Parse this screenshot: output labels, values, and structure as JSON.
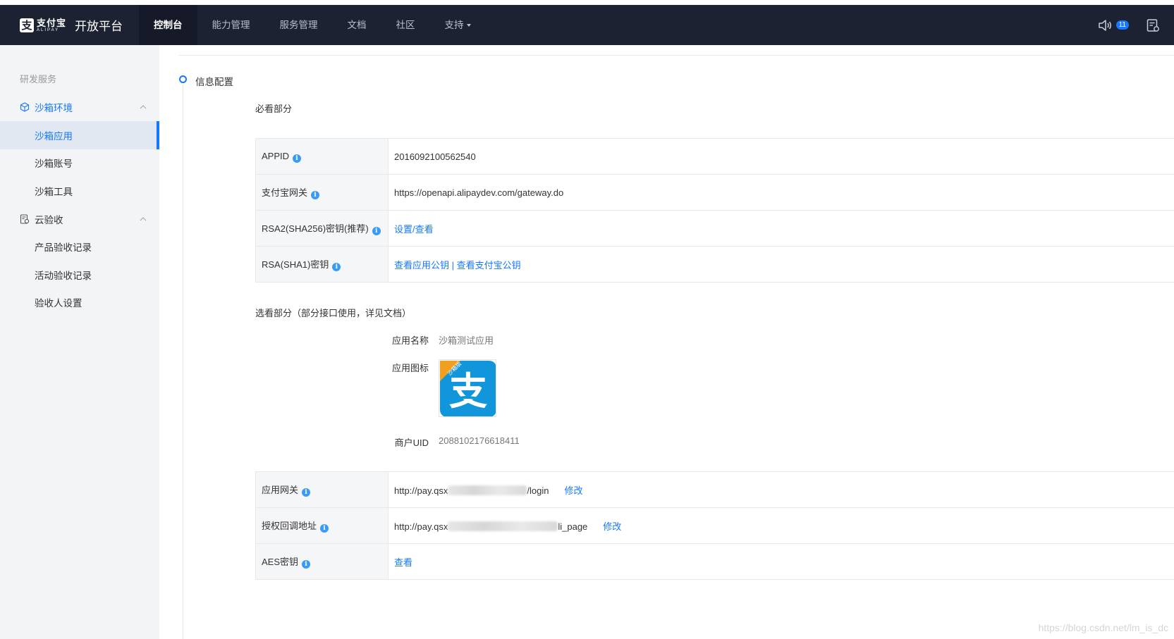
{
  "brand": {
    "logo_glyph": "支",
    "logo_cn": "支付宝",
    "logo_en": "ALIPAY",
    "platform_title": "开放平台"
  },
  "nav": {
    "items": [
      {
        "label": "控制台",
        "active": true
      },
      {
        "label": "能力管理"
      },
      {
        "label": "服务管理"
      },
      {
        "label": "文档"
      },
      {
        "label": "社区"
      },
      {
        "label": "支持"
      }
    ],
    "notification_count": "11"
  },
  "sidebar": {
    "group_title": "研发服务",
    "sandbox": {
      "label": "沙箱环境",
      "items": [
        "沙箱应用",
        "沙箱账号",
        "沙箱工具"
      ]
    },
    "cloud": {
      "label": "云验收",
      "items": [
        "产品验收记录",
        "活动验收记录",
        "验收人设置"
      ]
    }
  },
  "main": {
    "section_title": "信息配置",
    "required_title": "必看部分",
    "required_rows": [
      {
        "key": "APPID",
        "value": "2016092100562540"
      },
      {
        "key": "支付宝网关",
        "value": "https://openapi.alipaydev.com/gateway.do"
      },
      {
        "key": "RSA2(SHA256)密钥(推荐)",
        "link": "设置/查看"
      },
      {
        "key": "RSA(SHA1)密钥",
        "link": "查看应用公钥 | 查看支付宝公钥"
      }
    ],
    "optional_title": "选看部分（部分接口使用，详见文档）",
    "app_name_label": "应用名称",
    "app_name_value": "沙箱测试应用",
    "app_icon_label": "应用图标",
    "app_icon_ribbon": "沙箱版",
    "app_icon_glyph": "支",
    "merchant_uid_label": "商户UID",
    "merchant_uid_value": "2088102176618411",
    "extra_rows": [
      {
        "key": "应用网关",
        "value_prefix": "http://pay.qsx",
        "value_suffix": "/login",
        "edit": "修改"
      },
      {
        "key": "授权回调地址",
        "value_prefix": "http://pay.qsx",
        "value_suffix": "li_page",
        "edit": "修改"
      },
      {
        "key": "AES密钥",
        "link": "查看"
      }
    ]
  },
  "watermark": "https://blog.csdn.net/lm_is_dc",
  "colors": {
    "topbar": "#1d2233",
    "accent": "#1677ff",
    "sidebar_bg": "#f3f4f6",
    "alipay_blue": "#1296db"
  }
}
